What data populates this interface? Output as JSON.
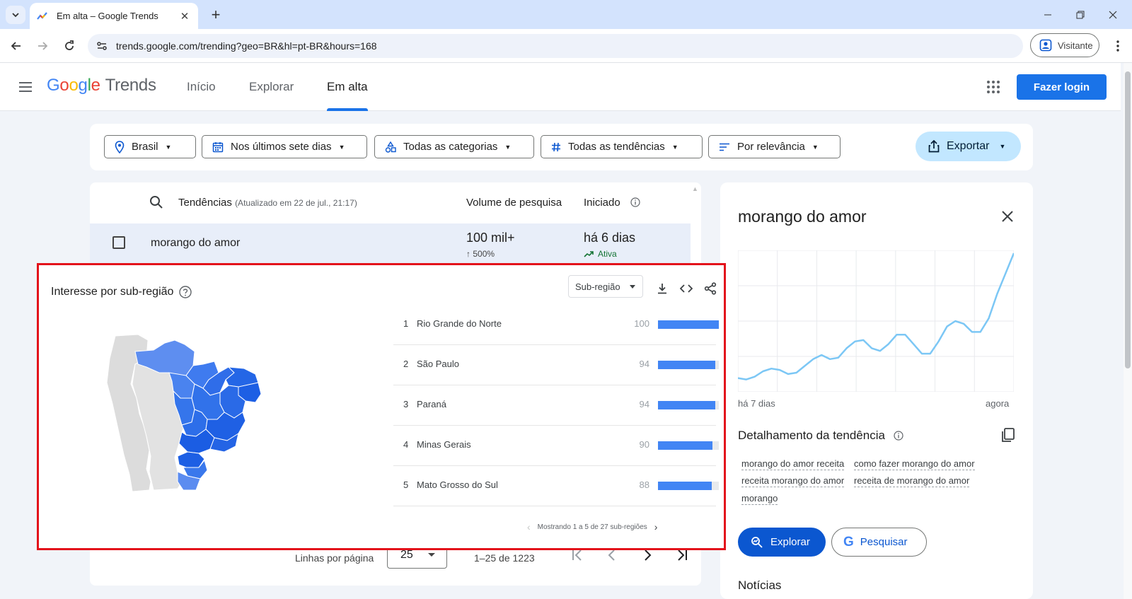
{
  "browser": {
    "tab_title": "Em alta – Google Trends",
    "url": "trends.google.com/trending?geo=BR&hl=pt-BR&hours=168",
    "profile_label": "Visitante"
  },
  "header": {
    "logo_google": [
      "G",
      "o",
      "o",
      "g",
      "l",
      "e"
    ],
    "logo_trends": "Trends",
    "nav": [
      {
        "label": "Início"
      },
      {
        "label": "Explorar"
      },
      {
        "label": "Em alta"
      }
    ],
    "login_label": "Fazer login"
  },
  "filters": {
    "location": "Brasil",
    "period": "Nos últimos sete dias",
    "categories": "Todas as categorias",
    "trends": "Todas as tendências",
    "sort": "Por relevância",
    "export_label": "Exportar"
  },
  "table": {
    "col_trends": "Tendências",
    "col_trends_sub": "(Atualizado em 22 de jul., 21:17)",
    "col_volume": "Volume de pesquisa",
    "col_started": "Iniciado",
    "rows": [
      {
        "name": "morango do amor",
        "volume": "100 mil+",
        "change": "500%",
        "started": "há 6 dias",
        "status": "Ativa"
      }
    ],
    "rows_per_page_label": "Linhas por página",
    "rows_per_page": "25",
    "range": "1–25 de 1223"
  },
  "subregion": {
    "title": "Interesse por sub-região",
    "select": "Sub-região",
    "items": [
      {
        "rank": "1",
        "name": "Rio Grande do Norte",
        "value": 100
      },
      {
        "rank": "2",
        "name": "São Paulo",
        "value": 94
      },
      {
        "rank": "3",
        "name": "Paraná",
        "value": 94
      },
      {
        "rank": "4",
        "name": "Minas Gerais",
        "value": 90
      },
      {
        "rank": "5",
        "name": "Mato Grosso do Sul",
        "value": 88
      }
    ],
    "pager_text": "Mostrando 1 a 5 de 27 sub-regiões"
  },
  "detail": {
    "title": "morango do amor",
    "x_start": "há 7 dias",
    "x_end": "agora",
    "breakdown_title": "Detalhamento da tendência",
    "terms": [
      "morango do amor receita",
      "como fazer morango do amor",
      "receita morango do amor",
      "receita de morango do amor",
      "morango"
    ],
    "explore_label": "Explorar",
    "search_label": "Pesquisar",
    "news_title": "Notícias"
  },
  "chart_data": {
    "type": "line",
    "series": [
      {
        "values": [
          8,
          7,
          9,
          13,
          15,
          14,
          11,
          12,
          17,
          22,
          25,
          22,
          23,
          30,
          35,
          36,
          30,
          28,
          33,
          40,
          40,
          33,
          26,
          26,
          35,
          46,
          50,
          48,
          42,
          42,
          52,
          70,
          85,
          100
        ]
      }
    ],
    "ylim": [
      0,
      100
    ],
    "grid": true,
    "color": "#7cc7f5"
  },
  "colors": {
    "accent": "#1a73e8",
    "highlight_border": "#e3121b",
    "bar": "#4285f4"
  }
}
